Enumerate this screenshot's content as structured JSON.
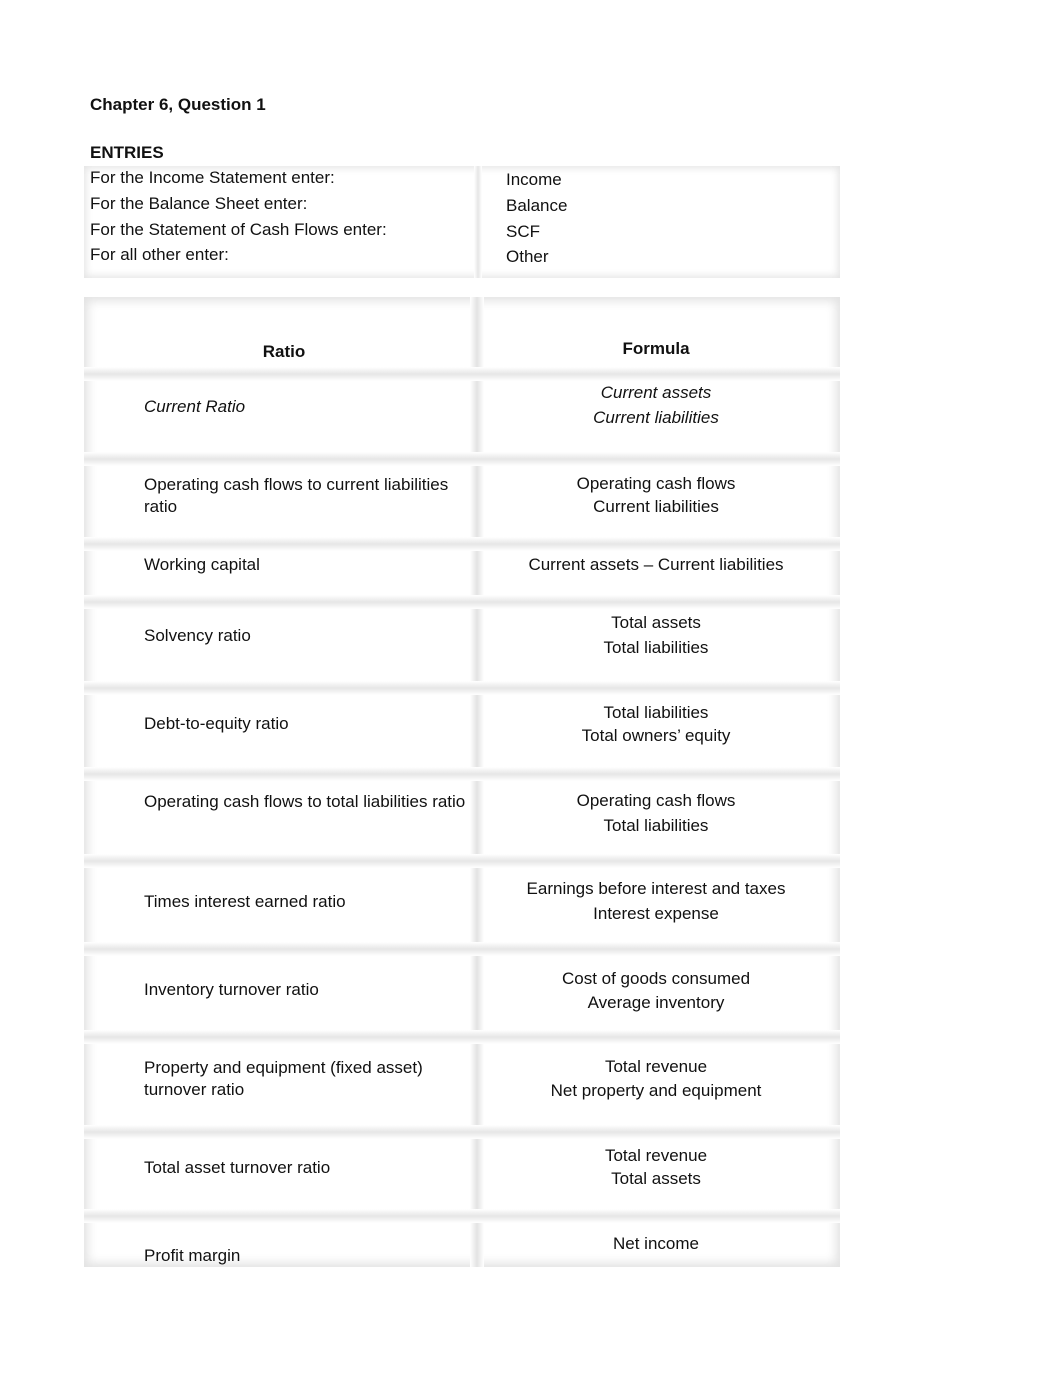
{
  "title": "Chapter 6, Question 1",
  "entries": {
    "label": "ENTRIES",
    "rows": [
      {
        "label": "For the Income Statement enter:",
        "value": "Income"
      },
      {
        "label": "For the Balance Sheet enter:",
        "value": "Balance"
      },
      {
        "label": "For the Statement of Cash Flows enter:",
        "value": "SCF"
      },
      {
        "label": "For all other enter:",
        "value": "Other"
      }
    ]
  },
  "ratios": {
    "headers": {
      "ratio": "Ratio",
      "formula": "Formula"
    },
    "rows": [
      {
        "ratio": "Current Ratio",
        "numerator": "Current assets",
        "denominator": "Current liabilities"
      },
      {
        "ratio": "Operating cash flows to current liabilities ratio",
        "numerator": "Operating cash flows",
        "denominator": "Current liabilities"
      },
      {
        "ratio": "Working capital",
        "numerator": "Current assets – Current liabilities",
        "denominator": ""
      },
      {
        "ratio": "Solvency ratio",
        "numerator": "Total assets",
        "denominator": "Total liabilities"
      },
      {
        "ratio": "Debt-to-equity ratio",
        "numerator": "Total liabilities",
        "denominator": "Total owners’ equity"
      },
      {
        "ratio": "Operating cash flows to total liabilities ratio",
        "numerator": "Operating cash flows",
        "denominator": "Total liabilities"
      },
      {
        "ratio": "Times interest earned ratio",
        "numerator": "Earnings before interest and taxes",
        "denominator": "Interest expense"
      },
      {
        "ratio": "Inventory turnover ratio",
        "numerator": "Cost of goods consumed",
        "denominator": "Average inventory"
      },
      {
        "ratio": "Property and equipment (fixed asset) turnover ratio",
        "numerator": "Total revenue",
        "denominator": "Net property and equipment"
      },
      {
        "ratio": "Total asset turnover ratio",
        "numerator": "Total revenue",
        "denominator": "Total assets"
      },
      {
        "ratio": "Profit margin",
        "numerator": "Net income",
        "denominator": ""
      }
    ]
  }
}
